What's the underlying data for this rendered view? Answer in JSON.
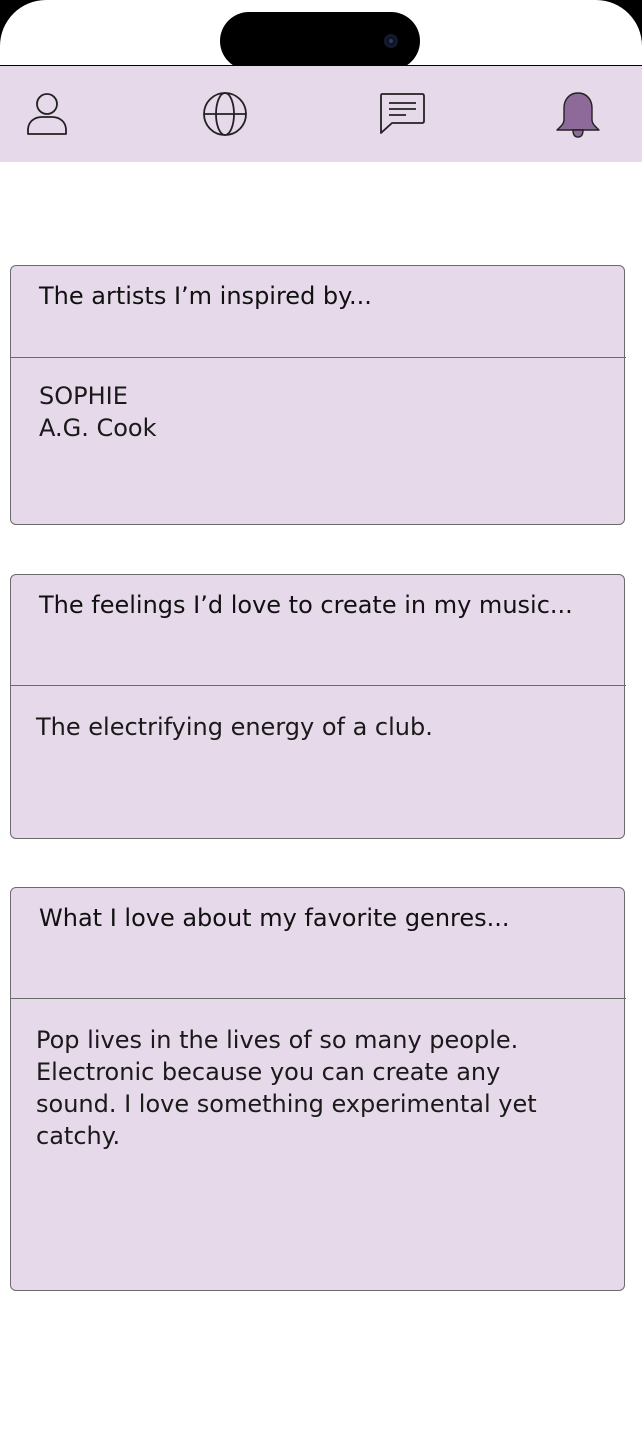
{
  "nav": {
    "items": [
      {
        "icon": "profile-icon"
      },
      {
        "icon": "globe-icon"
      },
      {
        "icon": "chat-icon"
      },
      {
        "icon": "bell-icon",
        "active": true
      }
    ],
    "active_color": "#8e6a9b",
    "bar_color": "#e6d9e9"
  },
  "cards": [
    {
      "title": "The artists I’m inspired by...",
      "body": "SOPHIE\nA.G. Cook"
    },
    {
      "title": "The feelings I’d love to create in my music...",
      "body": "The electrifying energy of a club."
    },
    {
      "title": "What I love about my favorite genres...",
      "body": "Pop lives in the lives of so many people. Electronic because you can create any sound. I love something experimental yet catchy."
    }
  ]
}
